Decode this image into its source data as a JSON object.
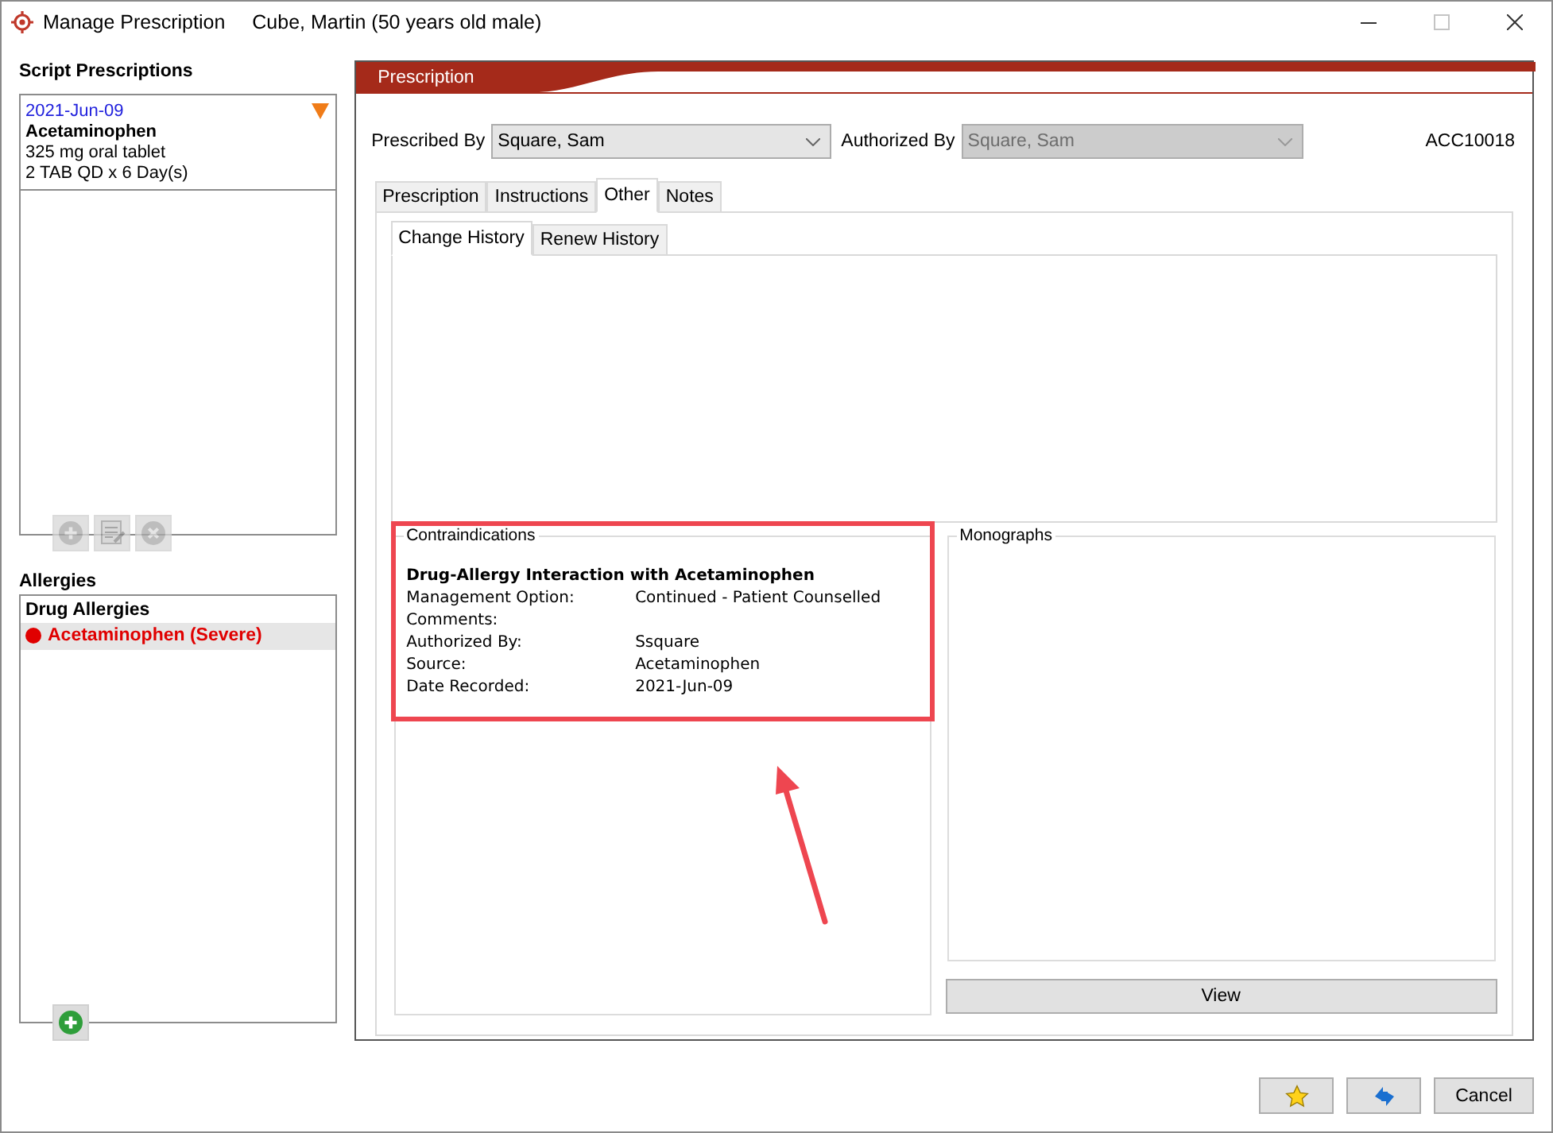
{
  "window": {
    "title": "Manage Prescription",
    "patient": "Cube, Martin (50 years old male)"
  },
  "script_prescriptions": {
    "heading": "Script Prescriptions",
    "items": [
      {
        "date": "2021-Jun-09",
        "drug": "Acetaminophen",
        "strength": "325 mg oral tablet",
        "directions": "2 TAB QD x 6 Day(s)",
        "flagged": true
      }
    ],
    "toolbar": [
      {
        "kind": "add",
        "disabled": true
      },
      {
        "kind": "edit",
        "disabled": true
      },
      {
        "kind": "remove",
        "disabled": true
      }
    ]
  },
  "allergies": {
    "heading": "Allergies",
    "group": "Drug Allergies",
    "items": [
      {
        "label": "Acetaminophen (Severe)",
        "color": "#e00000",
        "selected": true
      }
    ],
    "add_button": {
      "disabled": false
    }
  },
  "prescription": {
    "header": "Prescription",
    "prescribed_by": {
      "label": "Prescribed By",
      "value": "Square, Sam",
      "disabled": false
    },
    "authorized_by": {
      "label": "Authorized By",
      "value": "Square, Sam",
      "disabled": true
    },
    "id": "ACC10018",
    "tabs": [
      {
        "label": "Prescription",
        "selected": false
      },
      {
        "label": "Instructions",
        "selected": false
      },
      {
        "label": "Other",
        "selected": true
      },
      {
        "label": "Notes",
        "selected": false
      }
    ],
    "subtabs": [
      {
        "label": "Change History",
        "selected": true
      },
      {
        "label": "Renew History",
        "selected": false
      }
    ],
    "contraindications": {
      "legend": "Contraindications",
      "title": "Drug-Allergy Interaction with Acetaminophen",
      "rows": [
        {
          "label": "Management Option:",
          "value": "Continued - Patient Counselled"
        },
        {
          "label": "Comments:"
        },
        {
          "label": "Authorized By:",
          "value": "Ssquare"
        },
        {
          "label": "Source:",
          "value": "Acetaminophen"
        },
        {
          "label": "Date Recorded:",
          "value": "2021-Jun-09"
        }
      ]
    },
    "monographs": {
      "legend": "Monographs",
      "button": "View"
    }
  },
  "footer": {
    "buttons": [
      {
        "kind": "favorite"
      },
      {
        "kind": "renew"
      },
      {
        "kind": "text",
        "label": "Cancel"
      }
    ]
  }
}
